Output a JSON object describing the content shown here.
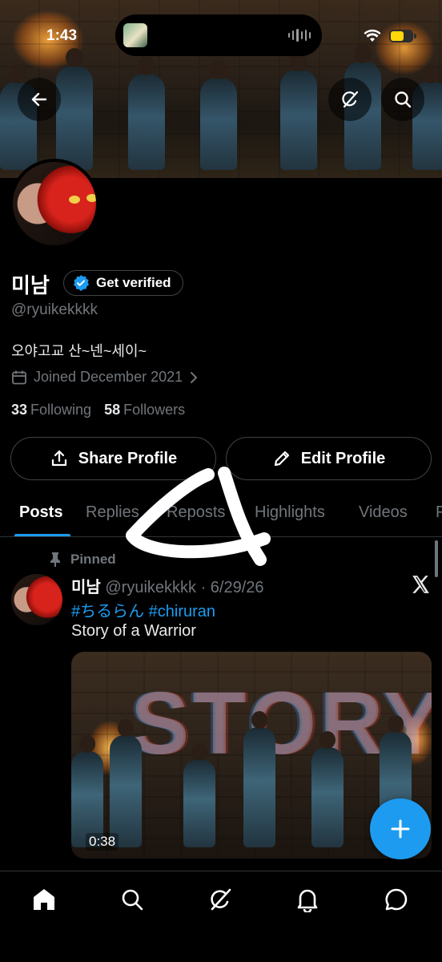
{
  "status_bar": {
    "time": "1:43"
  },
  "header": {
    "back_icon": "arrow-left-icon",
    "grok_icon": "grok-icon",
    "search_icon": "search-icon"
  },
  "profile": {
    "display_name": "미남",
    "verify_label": "Get verified",
    "handle": "@ryuikekkkk",
    "bio": "오야고교 산~넨~세이~",
    "joined": "Joined December 2021",
    "following_count": "33",
    "following_label": "Following",
    "followers_count": "58",
    "followers_label": "Followers",
    "share_label": "Share Profile",
    "edit_label": "Edit Profile"
  },
  "tabs": [
    {
      "label": "Posts",
      "active": true
    },
    {
      "label": "Replies"
    },
    {
      "label": "Reposts"
    },
    {
      "label": "Highlights"
    },
    {
      "label": "Videos"
    },
    {
      "label": "P"
    }
  ],
  "pinned_post": {
    "pinned_label": "Pinned",
    "author_name": "미남",
    "author_meta": "@ryuikekkkk · 6/29/26",
    "hashtags": "#ちるらん #chiruran",
    "text": "Story of a Warrior",
    "media_overlay_text": "STORY",
    "video_duration": "0:38"
  },
  "colors": {
    "accent": "#1d9bf0",
    "background": "#000000",
    "muted_text": "#71767b",
    "battery": "#ffd60a"
  },
  "bottom_nav": [
    "home-icon",
    "search-icon",
    "grok-icon",
    "notifications-icon",
    "messages-icon"
  ]
}
